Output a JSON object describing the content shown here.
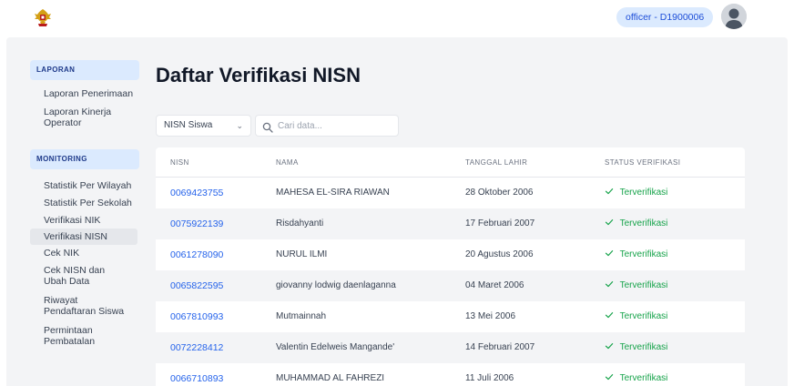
{
  "header": {
    "logo_icon": "garuda-emblem-icon",
    "user_label": "officer - D1900006",
    "avatar_icon": "user-avatar-icon"
  },
  "sidebar": {
    "sections": [
      {
        "title": "LAPORAN",
        "items": [
          {
            "label": "Laporan Penerimaan"
          },
          {
            "label": "Laporan Kinerja Operator"
          }
        ]
      },
      {
        "title": "MONITORING",
        "items": [
          {
            "label": "Statistik Per Wilayah"
          },
          {
            "label": "Statistik Per Sekolah"
          },
          {
            "label": "Verifikasi NIK"
          },
          {
            "label": "Verifikasi NISN",
            "active": true
          },
          {
            "label": "Cek NIK"
          },
          {
            "label": "Cek NISN dan Ubah Data"
          },
          {
            "label": "Riwayat Pendaftaran Siswa"
          },
          {
            "label": "Permintaan Pembatalan"
          }
        ]
      }
    ]
  },
  "main": {
    "title": "Daftar Verifikasi NISN",
    "filter": {
      "selected": "NISN Siswa",
      "chevron_icon": "chevron-down-icon"
    },
    "search": {
      "placeholder": "Cari data...",
      "icon": "search-icon"
    },
    "table": {
      "columns": [
        "NISN",
        "NAMA",
        "TANGGAL LAHIR",
        "STATUS VERIFIKASI"
      ],
      "status_icon": "check-icon",
      "rows": [
        {
          "nisn": "0069423755",
          "nama": "MAHESA EL-SIRA RIAWAN",
          "tanggal": "28 Oktober 2006",
          "status": "Terverifikasi"
        },
        {
          "nisn": "0075922139",
          "nama": "Risdahyanti",
          "tanggal": "17 Februari 2007",
          "status": "Terverifikasi"
        },
        {
          "nisn": "0061278090",
          "nama": "NURUL ILMI",
          "tanggal": "20 Agustus 2006",
          "status": "Terverifikasi"
        },
        {
          "nisn": "0065822595",
          "nama": "giovanny lodwig daenlaganna",
          "tanggal": "04 Maret 2006",
          "status": "Terverifikasi"
        },
        {
          "nisn": "0067810993",
          "nama": "Mutmainnah",
          "tanggal": "13 Mei 2006",
          "status": "Terverifikasi"
        },
        {
          "nisn": "0072228412",
          "nama": "Valentin Edelweis Mangande'",
          "tanggal": "14 Februari 2007",
          "status": "Terverifikasi"
        },
        {
          "nisn": "0066710893",
          "nama": "MUHAMMAD AL FAHREZI",
          "tanggal": "11 Juli 2006",
          "status": "Terverifikasi"
        }
      ]
    }
  },
  "colors": {
    "accent": "#2563eb",
    "success": "#16a34a",
    "section_bg": "#dbeafe",
    "panel_bg": "#f3f4f6"
  }
}
